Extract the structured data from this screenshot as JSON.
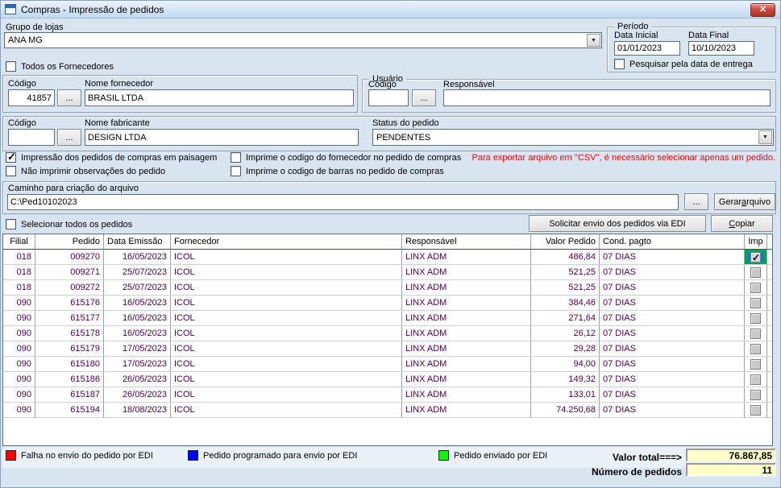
{
  "window": {
    "title": "Compras - Impressão de pedidos"
  },
  "icons": {
    "close": "✕",
    "dropdown": "▼",
    "browse": "..."
  },
  "grupo_lojas": {
    "label": "Grupo de lojas",
    "value": "ANA MG"
  },
  "periodo": {
    "title": "Período",
    "data_inicial_label": "Data Inicial",
    "data_inicial": "01/01/2023",
    "data_final_label": "Data Final",
    "data_final": "10/10/2023",
    "pesquisar": {
      "label": "Pesquisar pela data de entrega",
      "checked": false
    }
  },
  "todos_fornecedores": {
    "label": "Todos os Fornecedores",
    "checked": false
  },
  "fornecedor": {
    "codigo_label": "Código",
    "codigo": "41857",
    "nome_label": "Nome fornecedor",
    "nome": "BRASIL LTDA"
  },
  "usuario": {
    "title": "Usuário",
    "codigo_label": "Código",
    "codigo": "",
    "responsavel_label": "Responsável",
    "responsavel": ""
  },
  "fabricante": {
    "codigo_label": "Código",
    "codigo": "",
    "nome_label": "Nome fabricante",
    "nome": "DESIGN LTDA"
  },
  "status_pedido": {
    "label": "Status do pedido",
    "value": "PENDENTES"
  },
  "options": {
    "col1": [
      {
        "label": "Impressão dos pedidos de compras em paisagem",
        "checked": true
      },
      {
        "label": "Não imprimir observações do pedido",
        "checked": false
      }
    ],
    "col2": [
      {
        "label": "Imprime o codigo do fornecedor no pedido de compras",
        "checked": false
      },
      {
        "label": "Imprime o codigo de barras no pedido de compras",
        "checked": false
      }
    ],
    "csv_warning": "Para exportar arquivo em ''CSV'', é necessário selecionar apenas um pedido."
  },
  "caminho": {
    "label": "Caminho para criação do arquivo",
    "value": "C:\\Ped10102023",
    "gerar_button": {
      "pre": "Gerar ",
      "accel": "a",
      "post": "rquivo"
    }
  },
  "selecionar_todos": {
    "label": "Selecionar todos os pedidos",
    "checked": false
  },
  "actions": {
    "solicitar_edi": "Solicitar envio dos pedidos via EDI",
    "copiar": {
      "pre": "",
      "accel": "C",
      "post": "opiar"
    }
  },
  "grid": {
    "headers": [
      "Filial",
      "Pedido",
      "Data Emissão",
      "Fornecedor",
      "Responsável",
      "Valor Pedido",
      "Cond. pagto",
      "Imp"
    ],
    "rows": [
      {
        "filial": "018",
        "pedido": "009270",
        "data_emissao": "16/05/2023",
        "fornecedor": "ICOL",
        "responsavel": "LINX ADM",
        "valor": "486,84",
        "cond_pagto": "07 DIAS",
        "imp_checked": true,
        "selected": true
      },
      {
        "filial": "018",
        "pedido": "009271",
        "data_emissao": "25/07/2023",
        "fornecedor": "ICOL",
        "responsavel": "LINX ADM",
        "valor": "521,25",
        "cond_pagto": "07 DIAS",
        "imp_checked": false,
        "selected": false
      },
      {
        "filial": "018",
        "pedido": "009272",
        "data_emissao": "25/07/2023",
        "fornecedor": "ICOL",
        "responsavel": "LINX ADM",
        "valor": "521,25",
        "cond_pagto": "07 DIAS",
        "imp_checked": false,
        "selected": false
      },
      {
        "filial": "090",
        "pedido": "615176",
        "data_emissao": "16/05/2023",
        "fornecedor": "ICOL",
        "responsavel": "LINX ADM",
        "valor": "384,46",
        "cond_pagto": "07 DIAS",
        "imp_checked": false,
        "selected": false
      },
      {
        "filial": "090",
        "pedido": "615177",
        "data_emissao": "16/05/2023",
        "fornecedor": "ICOL",
        "responsavel": "LINX ADM",
        "valor": "271,64",
        "cond_pagto": "07 DIAS",
        "imp_checked": false,
        "selected": false
      },
      {
        "filial": "090",
        "pedido": "615178",
        "data_emissao": "16/05/2023",
        "fornecedor": "ICOL",
        "responsavel": "LINX ADM",
        "valor": "26,12",
        "cond_pagto": "07 DIAS",
        "imp_checked": false,
        "selected": false
      },
      {
        "filial": "090",
        "pedido": "615179",
        "data_emissao": "17/05/2023",
        "fornecedor": "ICOL",
        "responsavel": "LINX ADM",
        "valor": "29,28",
        "cond_pagto": "07 DIAS",
        "imp_checked": false,
        "selected": false
      },
      {
        "filial": "090",
        "pedido": "615180",
        "data_emissao": "17/05/2023",
        "fornecedor": "ICOL",
        "responsavel": "LINX ADM",
        "valor": "94,00",
        "cond_pagto": "07 DIAS",
        "imp_checked": false,
        "selected": false
      },
      {
        "filial": "090",
        "pedido": "615186",
        "data_emissao": "26/05/2023",
        "fornecedor": "ICOL",
        "responsavel": "LINX ADM",
        "valor": "149,32",
        "cond_pagto": "07 DIAS",
        "imp_checked": false,
        "selected": false
      },
      {
        "filial": "090",
        "pedido": "615187",
        "data_emissao": "26/05/2023",
        "fornecedor": "ICOL",
        "responsavel": "LINX ADM",
        "valor": "133,01",
        "cond_pagto": "07 DIAS",
        "imp_checked": false,
        "selected": false
      },
      {
        "filial": "090",
        "pedido": "615194",
        "data_emissao": "18/08/2023",
        "fornecedor": "ICOL",
        "responsavel": "LINX ADM",
        "valor": "74.250,68",
        "cond_pagto": "07 DIAS",
        "imp_checked": false,
        "selected": false
      }
    ]
  },
  "legend": [
    {
      "color": "#ff0000",
      "label": "Falha no envio do pedido por EDI"
    },
    {
      "color": "#0000ff",
      "label": "Pedido programado para envio por EDI"
    },
    {
      "color": "#00ff00",
      "label": "Pedido enviado por EDI"
    }
  ],
  "totals": {
    "valor_label": "Valor total===>",
    "valor": "76.867,85",
    "numero_label": "Número de pedidos",
    "numero": "11"
  },
  "colors": {
    "selected_cell_border": "#00a651",
    "selected_cell_bg": "#2e6ec6",
    "total_field_bg": "#ffffca",
    "warning_text": "#ff0000",
    "grid_text": "#4e004e"
  }
}
